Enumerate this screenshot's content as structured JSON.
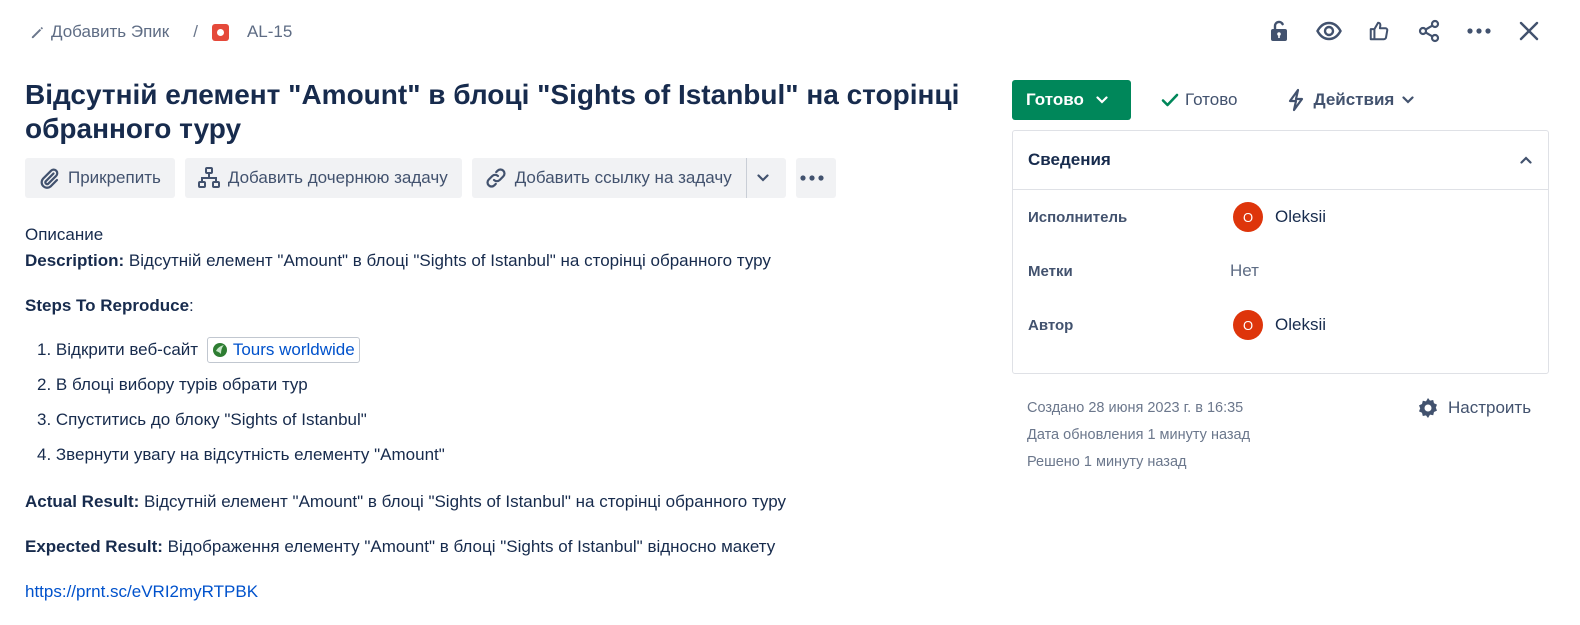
{
  "breadcrumb": {
    "add_epic": "Добавить Эпик",
    "separator": "/",
    "issue_key": "AL-15"
  },
  "top_icons": [
    "lock-open-icon",
    "eye-icon",
    "thumbs-up-icon",
    "share-icon",
    "more-icon",
    "close-icon"
  ],
  "issue": {
    "title": "Відсутній елемент \"Amount\" в блоці \"Sights of Istanbul\" на сторінці обранного туру"
  },
  "toolbar": {
    "attach": "Прикрепить",
    "add_child": "Добавить дочернюю задачу",
    "add_link": "Добавить ссылку на задачу"
  },
  "description": {
    "heading": "Описание",
    "desc_label": "Description:",
    "desc_text": " Відсутній елемент \"Amount\" в блоці \"Sights of Istanbul\"  на сторінці обранного туру",
    "steps_label": "Steps To Reproduce",
    "steps_colon": ":",
    "steps": [
      {
        "num": "1. ",
        "text": "Відкрити веб-сайт"
      },
      {
        "num": "2. ",
        "text": "В блоці вибору турів обрати тур"
      },
      {
        "num": "3. ",
        "text": "Спуститись до блоку \"Sights of Istanbul\""
      },
      {
        "num": "4. ",
        "text": "Звернути увагу на відсутність елементу \"Amount\""
      }
    ],
    "step1_link": "Tours worldwide",
    "actual_label": "Actual Result:",
    "actual_text": "  Відсутній елемент \"Amount\" в блоці \"Sights of Istanbul\"  на сторінці обранного туру",
    "expected_label": "Expected Result:",
    "expected_text": " Відображення елементу  \"Amount\" в блоці \"Sights of Istanbul\" відносно макету",
    "screenshot_link": "https://prnt.sc/eVRI2myRTPBK"
  },
  "status": {
    "button": "Готово",
    "resolution": "Готово",
    "actions": "Действия",
    "color": "#00875A"
  },
  "details": {
    "heading": "Сведения",
    "assignee_label": "Исполнитель",
    "assignee_initial": "O",
    "assignee_name": "Oleksii",
    "labels_label": "Метки",
    "labels_value": "Нет",
    "reporter_label": "Автор",
    "reporter_initial": "O",
    "reporter_name": "Oleksii"
  },
  "meta": {
    "created": "Создано 28 июня 2023 г. в 16:35",
    "updated": "Дата обновления 1 минуту назад",
    "resolved": "Решено 1 минуту назад",
    "configure": "Настроить"
  }
}
